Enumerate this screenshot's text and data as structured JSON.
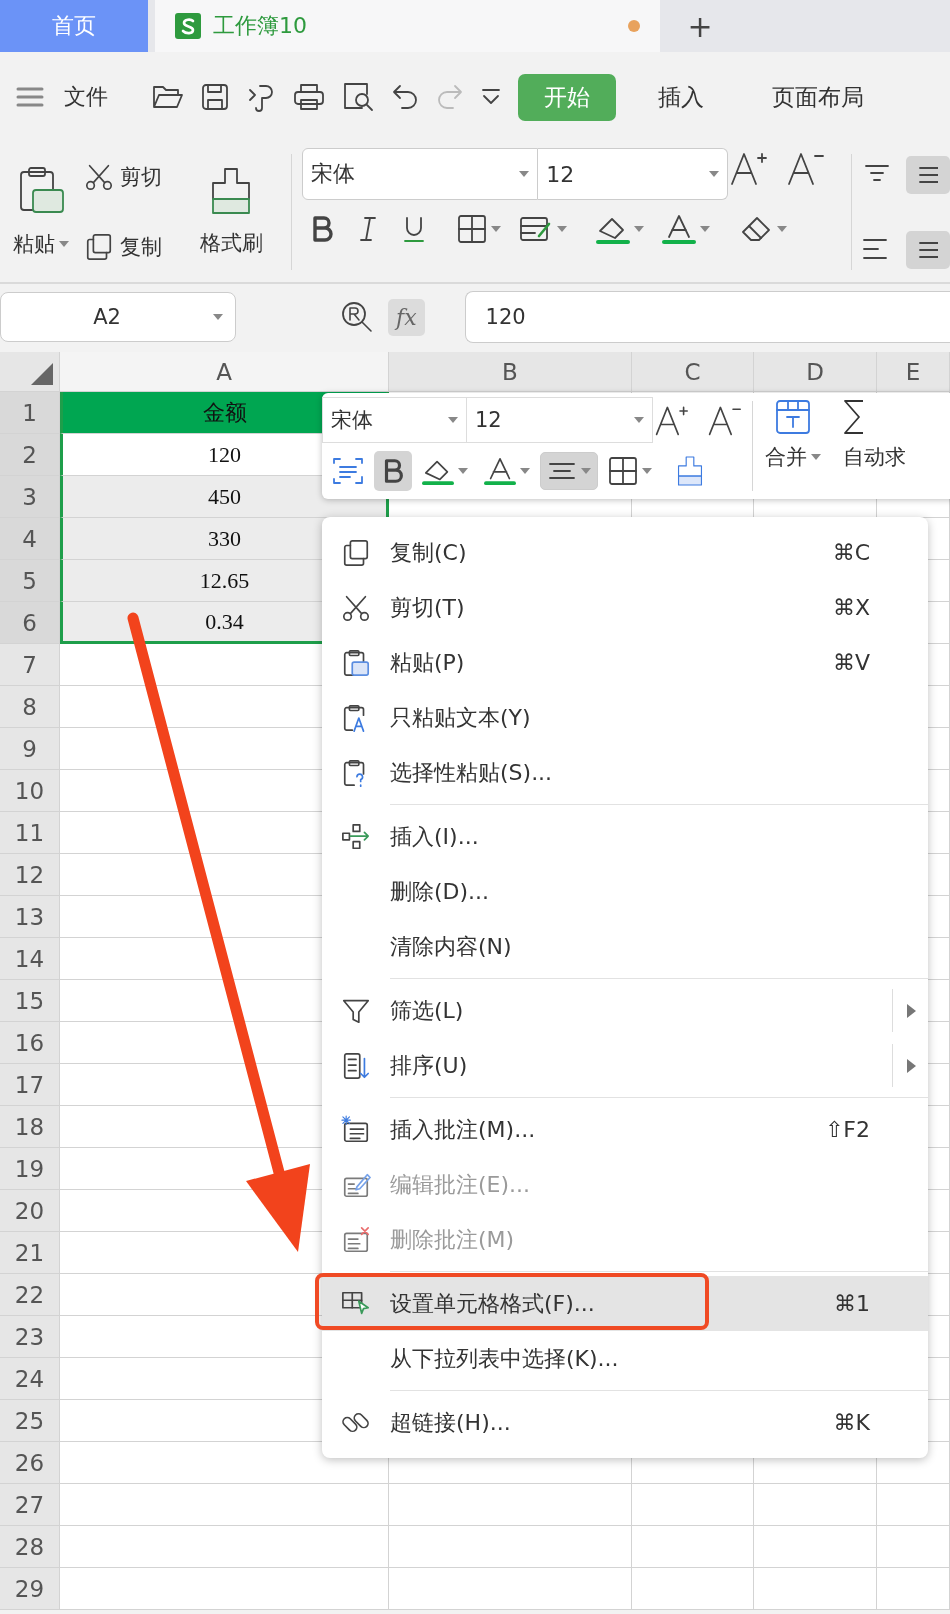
{
  "tabs": [
    {
      "kind": "home",
      "label": "首页",
      "selected": false,
      "unsaved": false
    },
    {
      "kind": "document",
      "label": "工作簿10",
      "selected": true,
      "unsaved": true
    }
  ],
  "new_tab": "+",
  "menubar": {
    "file": "文件",
    "ribbon_tabs": [
      {
        "label": "开始",
        "selected": true
      },
      {
        "label": "插入",
        "selected": false
      },
      {
        "label": "页面布局",
        "selected": false
      }
    ]
  },
  "ribbon": {
    "paste": "粘贴",
    "cut": "剪切",
    "copy": "复制",
    "format_painter": "格式刷",
    "font": "宋体",
    "font_size": "12"
  },
  "formula_bar": {
    "name_box": "A2",
    "fx": "fx",
    "value": "120"
  },
  "sheet": {
    "columns": [
      {
        "label": "A",
        "selected": true
      },
      {
        "label": "B",
        "selected": false
      },
      {
        "label": "C",
        "selected": false
      },
      {
        "label": "D",
        "selected": false
      },
      {
        "label": "E",
        "selected": false
      }
    ],
    "rows": [
      {
        "label": "1",
        "selected": true,
        "cells": [
          {
            "text": "金额",
            "kind": "header",
            "active": false
          }
        ]
      },
      {
        "label": "2",
        "selected": true,
        "cells": [
          {
            "text": "120",
            "kind": "value",
            "active": true
          }
        ]
      },
      {
        "label": "3",
        "selected": true,
        "cells": [
          {
            "text": "450",
            "kind": "value",
            "active": false
          }
        ]
      },
      {
        "label": "4",
        "selected": true,
        "cells": [
          {
            "text": "330",
            "kind": "value",
            "active": false
          }
        ]
      },
      {
        "label": "5",
        "selected": true,
        "cells": [
          {
            "text": "12.65",
            "kind": "value",
            "active": false
          }
        ]
      },
      {
        "label": "6",
        "selected": true,
        "cells": [
          {
            "text": "0.34",
            "kind": "value",
            "active": false
          }
        ]
      },
      {
        "label": "7",
        "selected": false
      },
      {
        "label": "8",
        "selected": false
      },
      {
        "label": "9",
        "selected": false
      },
      {
        "label": "10",
        "selected": false
      },
      {
        "label": "11",
        "selected": false
      },
      {
        "label": "12",
        "selected": false
      },
      {
        "label": "13",
        "selected": false
      },
      {
        "label": "14",
        "selected": false
      },
      {
        "label": "15",
        "selected": false
      },
      {
        "label": "16",
        "selected": false
      },
      {
        "label": "17",
        "selected": false
      },
      {
        "label": "18",
        "selected": false
      },
      {
        "label": "19",
        "selected": false
      },
      {
        "label": "20",
        "selected": false
      },
      {
        "label": "21",
        "selected": false
      },
      {
        "label": "22",
        "selected": false
      },
      {
        "label": "23",
        "selected": false
      },
      {
        "label": "24",
        "selected": false
      },
      {
        "label": "25",
        "selected": false
      },
      {
        "label": "26",
        "selected": false
      },
      {
        "label": "27",
        "selected": false
      },
      {
        "label": "28",
        "selected": false
      },
      {
        "label": "29",
        "selected": false
      }
    ]
  },
  "mini_toolbar": {
    "font": "宋体",
    "font_size": "12",
    "bold": true,
    "align_center": true,
    "merge": "合并",
    "autosum": "自动求"
  },
  "context_menu": {
    "groups": [
      [
        {
          "label": "复制(C)",
          "shortcut": "⌘C",
          "disabled": false,
          "selected": false,
          "submenu": false
        },
        {
          "label": "剪切(T)",
          "shortcut": "⌘X",
          "disabled": false,
          "selected": false,
          "submenu": false
        },
        {
          "label": "粘贴(P)",
          "shortcut": "⌘V",
          "disabled": false,
          "selected": false,
          "submenu": false
        },
        {
          "label": "只粘贴文本(Y)",
          "disabled": false,
          "selected": false,
          "submenu": false
        },
        {
          "label": "选择性粘贴(S)...",
          "disabled": false,
          "selected": false,
          "submenu": false
        }
      ],
      [
        {
          "label": "插入(I)...",
          "disabled": false,
          "selected": false,
          "submenu": false
        },
        {
          "label": "删除(D)...",
          "disabled": false,
          "selected": false,
          "submenu": false
        },
        {
          "label": "清除内容(N)",
          "disabled": false,
          "selected": false,
          "submenu": false
        }
      ],
      [
        {
          "label": "筛选(L)",
          "disabled": false,
          "selected": false,
          "submenu": true
        },
        {
          "label": "排序(U)",
          "disabled": false,
          "selected": false,
          "submenu": true
        }
      ],
      [
        {
          "label": "插入批注(M)...",
          "shortcut": "⇧F2",
          "disabled": false,
          "selected": false,
          "submenu": false
        },
        {
          "label": "编辑批注(E)...",
          "disabled": true,
          "selected": false,
          "submenu": false
        },
        {
          "label": "删除批注(M)",
          "disabled": true,
          "selected": false,
          "submenu": false
        }
      ],
      [
        {
          "label": "设置单元格格式(F)...",
          "shortcut": "⌘1",
          "disabled": false,
          "selected": true,
          "submenu": false
        },
        {
          "label": "从下拉列表中选择(K)...",
          "disabled": false,
          "selected": false,
          "submenu": false
        }
      ],
      [
        {
          "label": "超链接(H)...",
          "shortcut": "⌘K",
          "disabled": false,
          "selected": false,
          "submenu": false
        }
      ]
    ]
  }
}
